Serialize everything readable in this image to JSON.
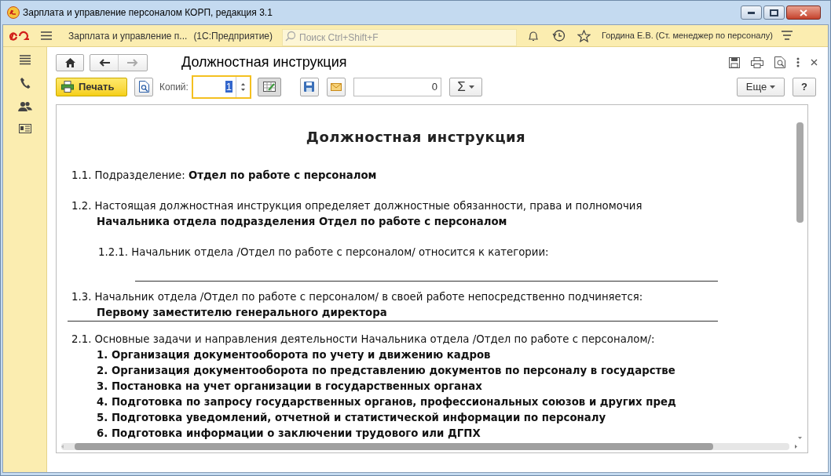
{
  "window": {
    "title": "Зарплата и управление персоналом КОРП, редакция 3.1"
  },
  "app_bar": {
    "section": "Зарплата и управление п...",
    "platform": "(1С:Предприятие)",
    "search": {
      "placeholder": "Поиск Ctrl+Shift+F"
    },
    "user": "Гордина Е.В. (Ст. менеджер по персоналу)"
  },
  "form": {
    "title": "Должностная инструкция",
    "print_button": "Печать",
    "copies_label": "Копий:",
    "copies_value": "1",
    "sum_field": "0",
    "sum_button": "Σ",
    "more_button": "Еще",
    "help_button": "?"
  },
  "document": {
    "heading": "Должностная инструкция",
    "blocks": [
      {
        "kind": "para",
        "text": "1.1. Подразделение: **Отдел по работе с персоналом**"
      },
      {
        "kind": "para",
        "text": "1.2. Настоящая должностная инструкция определяет должностные обязанности, права и полномочия"
      },
      {
        "kind": "cont",
        "text": "Начальника отдела подразделения Отдел по работе с персоналом"
      },
      {
        "kind": "subpara",
        "text": "1.2.1. Начальник отдела /Отдел по работе с персоналом/ относится к категории:"
      },
      {
        "kind": "blank"
      },
      {
        "kind": "para",
        "text": "1.3. Начальник отдела /Отдел по работе с персоналом/ в своей работе непосредственно подчиняется:"
      },
      {
        "kind": "underlined",
        "text": "Первому заместителю генерального директора"
      },
      {
        "kind": "para",
        "text": "2.1. Основные задачи и направления деятельности Начальника отдела /Отдел по работе с персоналом/:"
      },
      {
        "kind": "item",
        "text": "1. Организация документооборота по учету и движению кадров"
      },
      {
        "kind": "item",
        "text": "2. Организация документооборота по представлению документов по персоналу в государстве"
      },
      {
        "kind": "item",
        "text": "3. Постановка на учет организации в государственных органах"
      },
      {
        "kind": "item",
        "text": "4. Подготовка по запросу государственных органов, профессиональных союзов и других пред"
      },
      {
        "kind": "item",
        "text": "5. Подготовка уведомлений, отчетной и статистической информации по персоналу"
      },
      {
        "kind": "item",
        "text": "6. Подготовка информации о заключении трудового или ДГПХ"
      }
    ]
  }
}
